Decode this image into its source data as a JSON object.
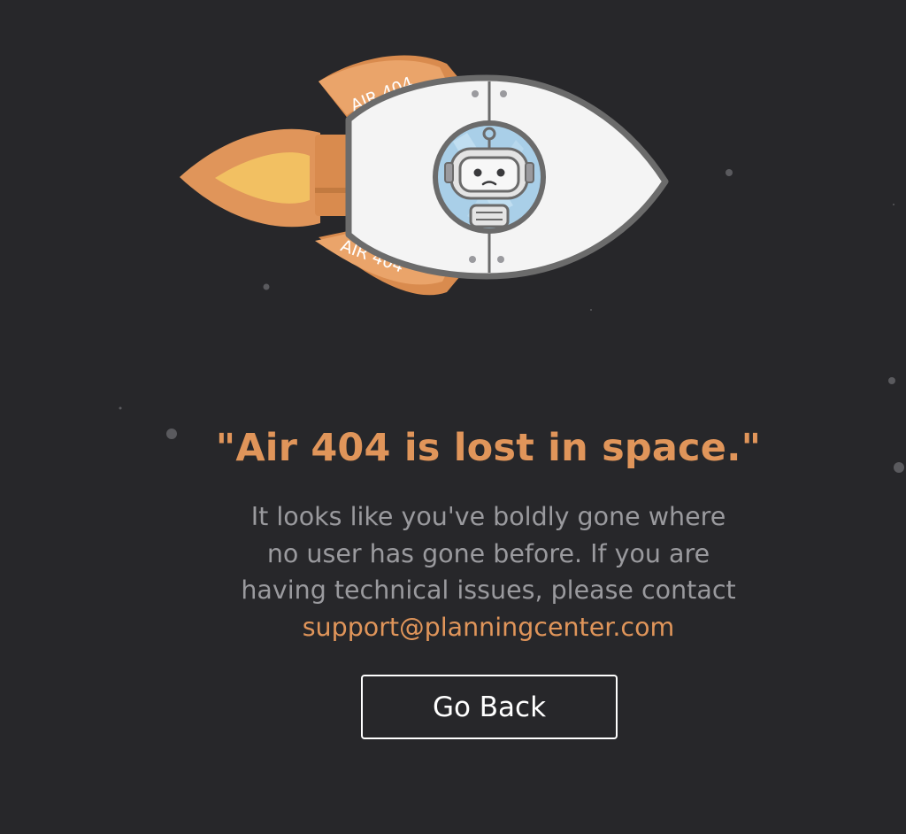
{
  "rocket": {
    "fin_label_top": "AIR 404",
    "fin_label_bottom": "AIR 404",
    "colors": {
      "fin": "#d98b4e",
      "fin_band": "#eaa46a",
      "flame_outer": "#e0955a",
      "flame_inner": "#f2c062",
      "body": "#f4f4f4",
      "outline": "#6b6b6b",
      "window": "#a9cfe8"
    }
  },
  "headline": "\"Air 404 is lost in space.\"",
  "message": {
    "line1": "It looks like you've boldly gone where",
    "line2": "no user has gone before. If you are",
    "line3": "having technical issues, please contact",
    "email": "support@planningcenter.com"
  },
  "go_back_label": "Go Back",
  "colors": {
    "background": "#27272a",
    "accent": "#e0955a",
    "body_text": "#9a9a9e",
    "button_border": "#ffffff"
  },
  "icons": {
    "illustration": "rocket-illustration",
    "passenger": "robot-icon"
  }
}
